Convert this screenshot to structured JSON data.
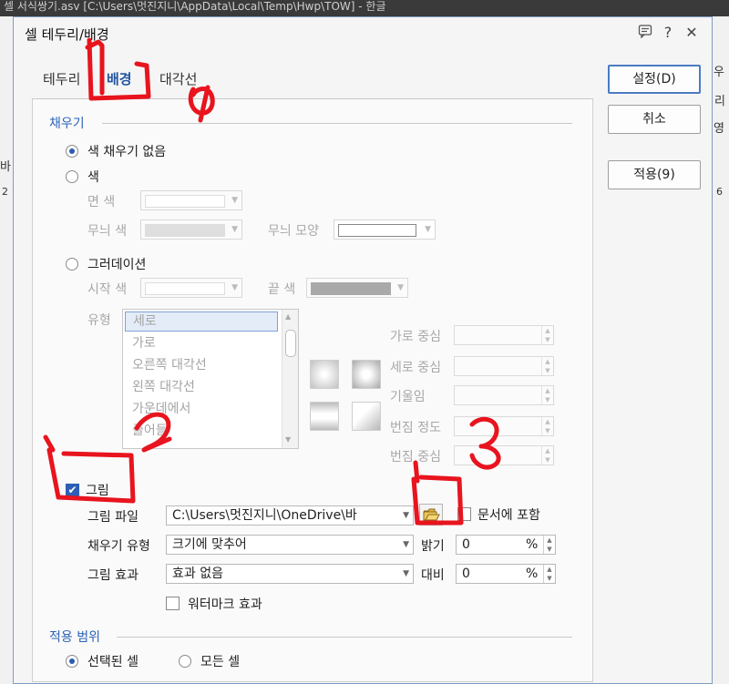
{
  "background": {
    "window_title": "셀 서식쌍기.asv [C:\\Users\\멋진지니\\AppData\\Local\\Temp\\Hwp\\TOW] - 한글",
    "right_fragments": [
      "우",
      "리",
      "영"
    ],
    "left_fragments": [
      "바",
      "2"
    ],
    "ruler_right": "6"
  },
  "dialog": {
    "title": "셀 테두리/배경",
    "title_icons": [
      "comment-icon",
      "help-icon",
      "close-icon"
    ],
    "help_glyph": "?",
    "close_glyph": "✕",
    "tabs": [
      {
        "label": "테두리",
        "active": false
      },
      {
        "label": "배경",
        "active": true
      },
      {
        "label": "대각선",
        "active": false
      }
    ],
    "buttons": {
      "ok": "설정(D)",
      "cancel": "취소",
      "apply": "적용(9)"
    }
  },
  "fill": {
    "section_title": "채우기",
    "no_fill_label": "색 채우기 없음",
    "color_label": "색",
    "face_color_label": "면 색",
    "pattern_color_label": "무늬 색",
    "pattern_shape_label": "무늬 모양",
    "gradation_label": "그러데이션",
    "start_color_label": "시작 색",
    "end_color_label": "끝 색",
    "type_label": "유형",
    "gradation_types": [
      "세로",
      "가로",
      "오른쪽 대각선",
      "왼쪽 대각선",
      "가운데에서",
      "줄어들"
    ],
    "h_center_label": "가로 중심",
    "v_center_label": "세로 중심",
    "tilt_label": "기울임",
    "blur_label": "번짐 정도",
    "blur_center_label": "번짐 중심",
    "picture_label": "그림",
    "picture_checked": true,
    "picture_file_label": "그림 파일",
    "picture_file_value": "C:\\Users\\멋진지니\\OneDrive\\바",
    "include_in_doc_label": "문서에 포함",
    "fill_type_label": "채우기 유형",
    "fill_type_value": "크기에 맞추어",
    "brightness_label": "밝기",
    "brightness_value": "0",
    "picture_effect_label": "그림 효과",
    "picture_effect_value": "효과 없음",
    "contrast_label": "대비",
    "contrast_value": "0",
    "percent": "%",
    "watermark_label": "워터마크 효과"
  },
  "scope": {
    "section_title": "적용 범위",
    "selected_cells_label": "선택된 셀",
    "all_cells_label": "모든 셀",
    "selected": "selected_cells"
  },
  "colors": {
    "accent": "#2b63b8",
    "annotation_red": "#e8141e"
  },
  "annotations": [
    "1",
    "2",
    "3"
  ]
}
